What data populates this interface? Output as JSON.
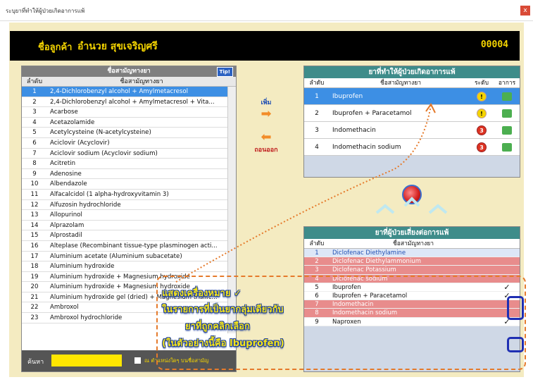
{
  "window": {
    "title": "ระบุยาที่ทำให้ผู้ป่วยเกิดอาการแพ้",
    "close": "x"
  },
  "customer": {
    "label": "ชื่อลูกค้า",
    "name": "อำนวย สุขเจริญศรี",
    "code": "00004"
  },
  "left": {
    "title": "ชื่อสามัญทางยา",
    "tip": "Tip!",
    "col_index": "ลำดับ",
    "col_name": "ชื่อสามัญทางยา",
    "rows": [
      {
        "n": "1",
        "name": "2,4-Dichlorobenzyl alcohol + Amylmetacresol"
      },
      {
        "n": "2",
        "name": "2,4-Dichlorobenzyl alcohol + Amylmetacresol + Vita..."
      },
      {
        "n": "3",
        "name": "Acarbose"
      },
      {
        "n": "4",
        "name": "Acetazolamide"
      },
      {
        "n": "5",
        "name": "Acetylcysteine (N-acetylcysteine)"
      },
      {
        "n": "6",
        "name": "Aciclovir (Acyclovir)"
      },
      {
        "n": "7",
        "name": "Aciclovir sodium (Acyclovir sodium)"
      },
      {
        "n": "8",
        "name": "Acitretin"
      },
      {
        "n": "9",
        "name": "Adenosine"
      },
      {
        "n": "10",
        "name": "Albendazole"
      },
      {
        "n": "11",
        "name": "Alfacalcidol (1 alpha-hydroxyvitamin 3)"
      },
      {
        "n": "12",
        "name": "Alfuzosin hydrochloride"
      },
      {
        "n": "13",
        "name": "Allopurinol"
      },
      {
        "n": "14",
        "name": "Alprazolam"
      },
      {
        "n": "15",
        "name": "Alprostadil"
      },
      {
        "n": "16",
        "name": "Alteplase (Recombinant tissue-type plasminogen acti..."
      },
      {
        "n": "17",
        "name": "Aluminium acetate (Aluminium subacetate)"
      },
      {
        "n": "18",
        "name": "Aluminium hydroxide"
      },
      {
        "n": "19",
        "name": "Aluminium hydroxide + Magnesium hydroxide"
      },
      {
        "n": "20",
        "name": "Aluminium hydroxide + Magnesium hydroxide"
      },
      {
        "n": "21",
        "name": "Aluminium hydroxide gel (dried) + Magnesium trisilic..."
      },
      {
        "n": "22",
        "name": "Ambroxol"
      },
      {
        "n": "23",
        "name": "Ambroxol hydrochloride"
      }
    ],
    "search_label": "ค้นหา",
    "search_value": "",
    "search_option": "ณ ตำแหน่งใดๆ บนชื่อสามัญ"
  },
  "buttons": {
    "add": "เพิ่ม",
    "remove": "ถอนออก"
  },
  "allergy": {
    "title": "ยาที่ทำให้ผู้ป่วยเกิดอาการแพ้",
    "col_index": "ลำดับ",
    "col_name": "ชื่อสามัญทางยา",
    "col_level": "ระดับ",
    "col_symptom": "อาการ",
    "rows": [
      {
        "n": "1",
        "name": "Ibuprofen",
        "level": "!",
        "level_color": "yellow"
      },
      {
        "n": "2",
        "name": "Ibuprofen + Paracetamol",
        "level": "!",
        "level_color": "yellow"
      },
      {
        "n": "3",
        "name": "Indomethacin",
        "level": "3",
        "level_color": "red"
      },
      {
        "n": "4",
        "name": "Indomethacin sodium",
        "level": "3",
        "level_color": "red"
      }
    ]
  },
  "risk": {
    "title": "ยาที่ผู้ป่วยเสี่ยงต่อการแพ้",
    "col_index": "ลำดับ",
    "col_name": "ชื่อสามัญทางยา",
    "rows": [
      {
        "n": "1",
        "name": "Diclofenac Diethylamine",
        "style": "blue",
        "check": ""
      },
      {
        "n": "2",
        "name": "Diclofenac Diethylammonium",
        "style": "red",
        "check": ""
      },
      {
        "n": "3",
        "name": "Diclofenac Potassium",
        "style": "red",
        "check": ""
      },
      {
        "n": "4",
        "name": "Diclofenac sodium",
        "style": "red",
        "check": ""
      },
      {
        "n": "5",
        "name": "Ibuprofen",
        "style": "white",
        "check": "✓"
      },
      {
        "n": "6",
        "name": "Ibuprofen + Paracetamol",
        "style": "white",
        "check": "✓"
      },
      {
        "n": "7",
        "name": "Indomethacin",
        "style": "red",
        "check": ""
      },
      {
        "n": "8",
        "name": "Indomethacin sodium",
        "style": "red",
        "check": ""
      },
      {
        "n": "9",
        "name": "Naproxen",
        "style": "white",
        "check": "✓"
      }
    ]
  },
  "annotation": {
    "line1": "แสดงเครื่องหมาย ✓",
    "line2": "ในรายการที่เป็นยากลุ่มเดียวกับ",
    "line3": "ยาที่ถูกคลิกเลือก",
    "line4": "(ในตัวอย่างนี้คือ Ibuprofen)"
  },
  "colors": {
    "accent": "#3d8fe4",
    "header_bg": "#000000",
    "header_text": "#f4d400",
    "panel_bg": "#f4ebc1",
    "teal": "#3e8c8a",
    "risk_red": "#e88c8c"
  }
}
